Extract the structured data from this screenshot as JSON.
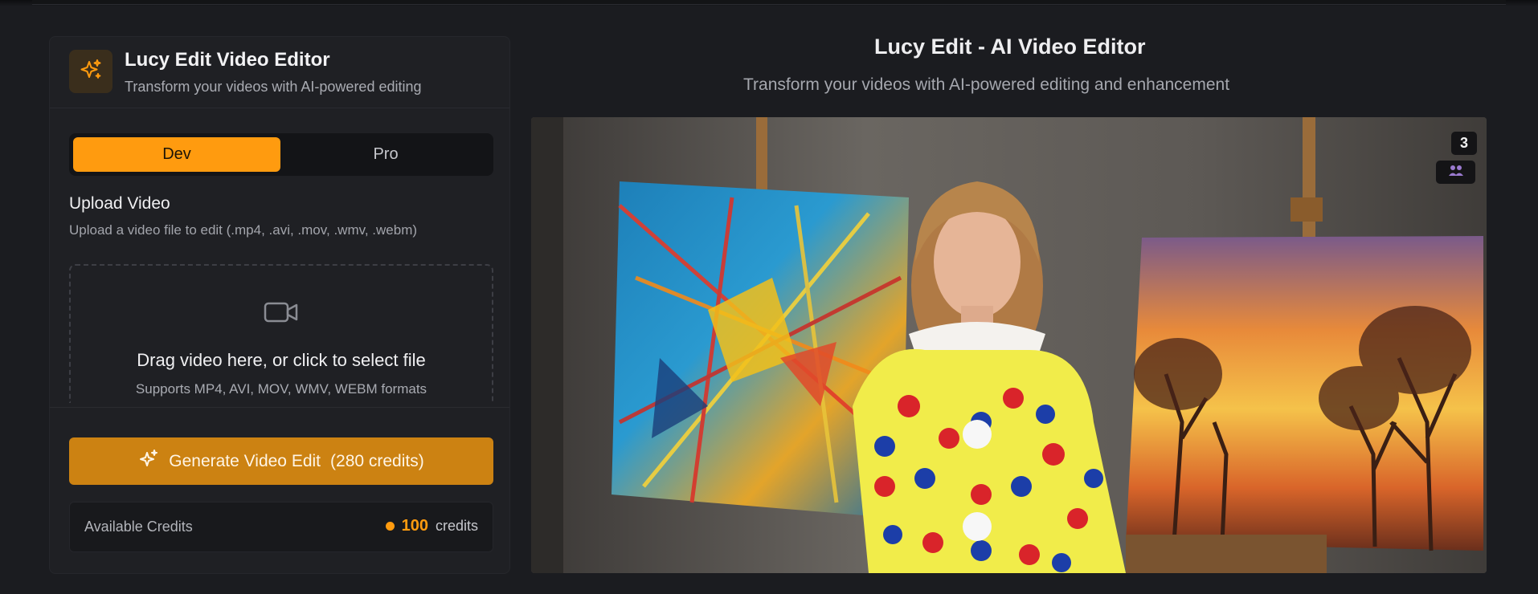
{
  "sidebar": {
    "title": "Lucy Edit Video Editor",
    "subtitle": "Transform your videos with AI-powered editing",
    "logo_icon": "sparkles-icon",
    "tabs": [
      {
        "label": "Dev",
        "active": true
      },
      {
        "label": "Pro",
        "active": false
      }
    ],
    "upload": {
      "title": "Upload Video",
      "description": "Upload a video file to edit (.mp4, .avi, .mov, .wmv, .webm)",
      "dropzone_icon": "video-camera-icon",
      "dropzone_title": "Drag video here, or click to select file",
      "dropzone_hint": "Supports MP4, AVI, MOV, WMV, WEBM formats"
    },
    "generate_button": {
      "label": "Generate Video Edit",
      "cost": "(280 credits)",
      "icon": "sparkles-icon"
    },
    "credits": {
      "label": "Available Credits",
      "value": "100",
      "unit": "credits"
    }
  },
  "main": {
    "title": "Lucy Edit - AI Video Editor",
    "subtitle": "Transform your videos with AI-powered editing and enhancement",
    "video": {
      "count_badge": "3",
      "badge_icon": "users-icon"
    }
  },
  "colors": {
    "accent": "#ff9b0f",
    "button": "#cc8212",
    "background": "#1b1c20",
    "panel": "#1f2024"
  }
}
